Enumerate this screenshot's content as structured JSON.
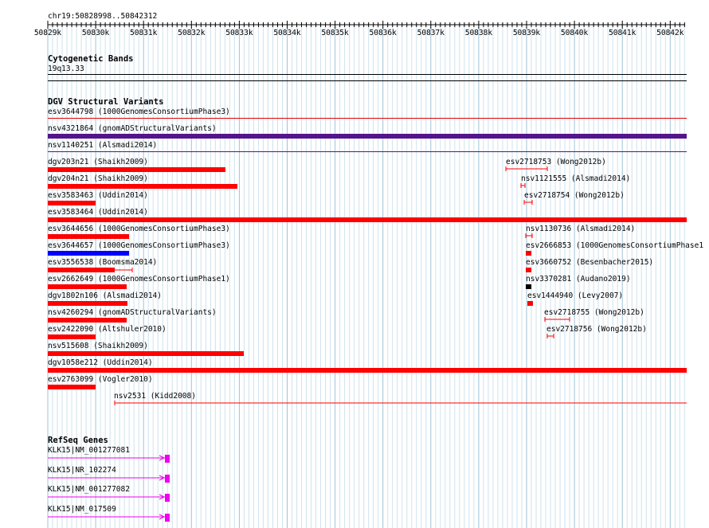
{
  "ruler": {
    "location": "chr19:50828998..50842312",
    "ticks": [
      "50829k",
      "50830k",
      "50831k",
      "50832k",
      "50833k",
      "50834k",
      "50835k",
      "50836k",
      "50837k",
      "50838k",
      "50839k",
      "50840k",
      "50841k",
      "50842k"
    ]
  },
  "tracks": {
    "cytoband": {
      "title": "Cytogenetic Bands",
      "band": "19q13.33"
    },
    "dgv": {
      "title": "DGV Structural Variants",
      "features": [
        {
          "label": "esv3644798 (1000GenomesConsortiumPhase3)",
          "style": "thin",
          "color": "#e00000"
        },
        {
          "label": "nsv4321864 (gnomADStructuralVariants)",
          "style": "bar",
          "color": "#55148c"
        },
        {
          "label": "nsv1140251 (Alsmadi2014)",
          "style": "thin",
          "color": "#55148c"
        },
        {
          "label": "dgv203n21 (Shaikh2009)",
          "style": "bar",
          "color": "#ff0000"
        },
        {
          "label": "esv2718753 (Wong2012b)",
          "style": "whisker",
          "color": "#ff0000"
        },
        {
          "label": "dgv204n21 (Shaikh2009)",
          "style": "bar",
          "color": "#ff0000"
        },
        {
          "label": "nsv1121555 (Alsmadi2014)",
          "style": "whisker",
          "color": "#ff0000"
        },
        {
          "label": "esv3583463 (Uddin2014)",
          "style": "bar",
          "color": "#ff0000"
        },
        {
          "label": "esv2718754 (Wong2012b)",
          "style": "whisker",
          "color": "#ff0000"
        },
        {
          "label": "esv3583464 (Uddin2014)",
          "style": "bar",
          "color": "#ff0000"
        },
        {
          "label": "esv3644656 (1000GenomesConsortiumPhase3)",
          "style": "bar",
          "color": "#ff0000"
        },
        {
          "label": "nsv1130736 (Alsmadi2014)",
          "style": "whisker",
          "color": "#ff0000"
        },
        {
          "label": "esv3644657 (1000GenomesConsortiumPhase3)",
          "style": "bar",
          "color": "#0000ff"
        },
        {
          "label": "esv2666853 (1000GenomesConsortiumPhase1",
          "style": "bar",
          "color": "#ff0000"
        },
        {
          "label": "esv3556538 (Boomsma2014)",
          "style": "barwhisker",
          "color": "#ff0000"
        },
        {
          "label": "esv3660752 (Besenbacher2015)",
          "style": "bar",
          "color": "#ff0000"
        },
        {
          "label": "esv2662649 (1000GenomesConsortiumPhase1)",
          "style": "bar",
          "color": "#ff0000"
        },
        {
          "label": "nsv3370281 (Audano2019)",
          "style": "bar",
          "color": "#000000"
        },
        {
          "label": "dgv1802n106 (Alsmadi2014)",
          "style": "bar",
          "color": "#ff0000"
        },
        {
          "label": "esv1444940 (Levy2007)",
          "style": "bar",
          "color": "#ff0000"
        },
        {
          "label": "nsv4260294 (gnomADStructuralVariants)",
          "style": "bar",
          "color": "#ff0000"
        },
        {
          "label": "esv2718755 (Wong2012b)",
          "style": "whisker",
          "color": "#ff0000"
        },
        {
          "label": "esv2422090 (Altshuler2010)",
          "style": "bar",
          "color": "#ff0000"
        },
        {
          "label": "esv2718756 (Wong2012b)",
          "style": "whisker",
          "color": "#ff0000"
        },
        {
          "label": "nsv515608 (Shaikh2009)",
          "style": "bar",
          "color": "#ff0000"
        },
        {
          "label": "dgv1058e212 (Uddin2014)",
          "style": "bar",
          "color": "#ff0000"
        },
        {
          "label": "esv2763099 (Vogler2010)",
          "style": "bar",
          "color": "#ff0000"
        },
        {
          "label": "nsv2531 (Kidd2008)",
          "style": "thin",
          "color": "#ff0000"
        }
      ]
    },
    "refseq": {
      "title": "RefSeq Genes",
      "features": [
        {
          "label": "KLK15|NM_001277081",
          "color": "#ee00ee"
        },
        {
          "label": "KLK15|NR_102274",
          "color": "#ee00ee"
        },
        {
          "label": "KLK15|NM_001277082",
          "color": "#ee00ee"
        },
        {
          "label": "KLK15|NM_017509",
          "color": "#ee00ee"
        }
      ]
    }
  }
}
